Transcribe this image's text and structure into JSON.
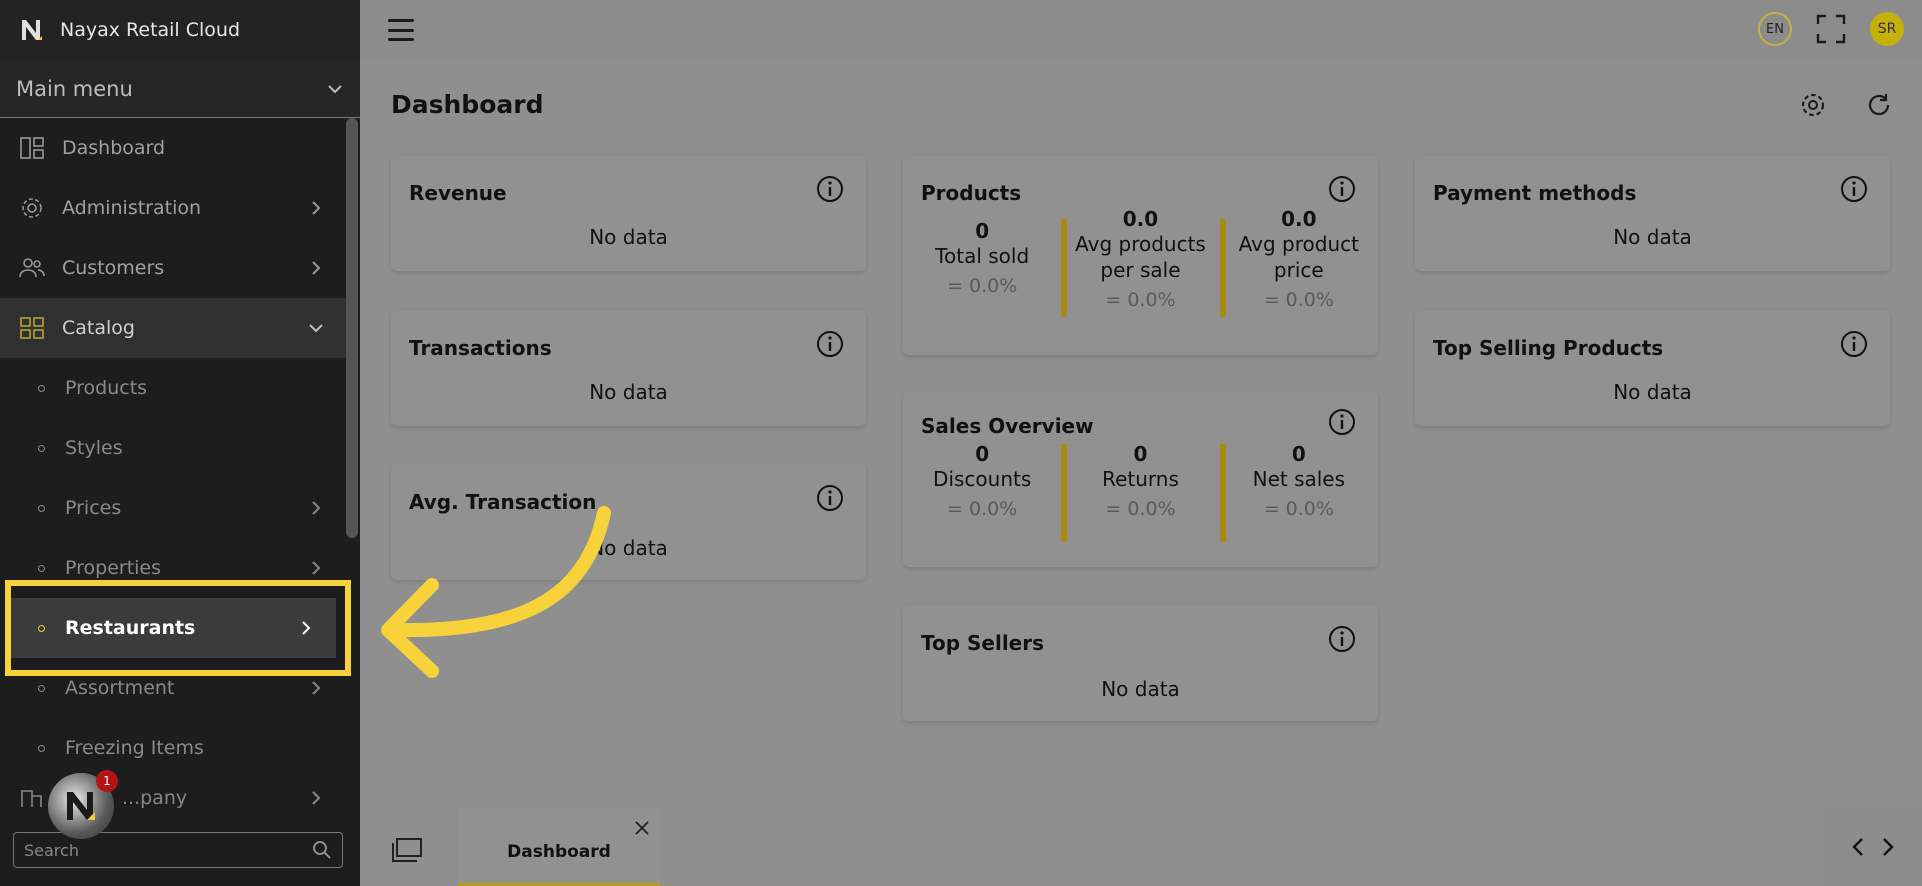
{
  "brand": {
    "title": "Nayax Retail Cloud"
  },
  "sidebar": {
    "main_menu": "Main menu",
    "items": [
      {
        "label": "Dashboard",
        "icon": "dashboard-icon"
      },
      {
        "label": "Administration",
        "icon": "gear-icon"
      },
      {
        "label": "Customers",
        "icon": "users-icon"
      },
      {
        "label": "Catalog",
        "icon": "grid-icon"
      }
    ],
    "sub_items": [
      {
        "label": "Products"
      },
      {
        "label": "Styles"
      },
      {
        "label": "Prices"
      },
      {
        "label": "Properties"
      },
      {
        "label": "Restaurants"
      },
      {
        "label": "Assortment"
      },
      {
        "label": "Freezing Items"
      }
    ],
    "partial_item": "...pany",
    "search_placeholder": "Search",
    "help_badge": "1"
  },
  "topbar": {
    "lang": "EN",
    "avatar": "SR"
  },
  "page": {
    "title": "Dashboard"
  },
  "cards": {
    "revenue": {
      "title": "Revenue",
      "body": "No data"
    },
    "transactions": {
      "title": "Transactions",
      "body": "No data"
    },
    "avg_transaction": {
      "title": "Avg. Transaction",
      "body": "No data"
    },
    "products": {
      "title": "Products",
      "metrics": [
        {
          "value": "0",
          "label": "Total sold",
          "change": "= 0.0%"
        },
        {
          "value": "0.0",
          "label": "Avg products per sale",
          "change": "= 0.0%"
        },
        {
          "value": "0.0",
          "label": "Avg product price",
          "change": "= 0.0%"
        }
      ]
    },
    "sales_overview": {
      "title": "Sales Overview",
      "metrics": [
        {
          "value": "0",
          "label": "Discounts",
          "change": "= 0.0%"
        },
        {
          "value": "0",
          "label": "Returns",
          "change": "= 0.0%"
        },
        {
          "value": "0",
          "label": "Net sales",
          "change": "= 0.0%"
        }
      ]
    },
    "top_sellers": {
      "title": "Top Sellers",
      "body": "No data"
    },
    "payment_methods": {
      "title": "Payment methods",
      "body": "No data"
    },
    "top_selling_products": {
      "title": "Top Selling Products",
      "body": "No data"
    }
  },
  "bottom": {
    "tab_label": "Dashboard"
  },
  "colors": {
    "accent": "#f8d23a",
    "sidebar": "#1d1d1d",
    "overlay": "#8f8f8f",
    "separator": "#a88a10"
  }
}
